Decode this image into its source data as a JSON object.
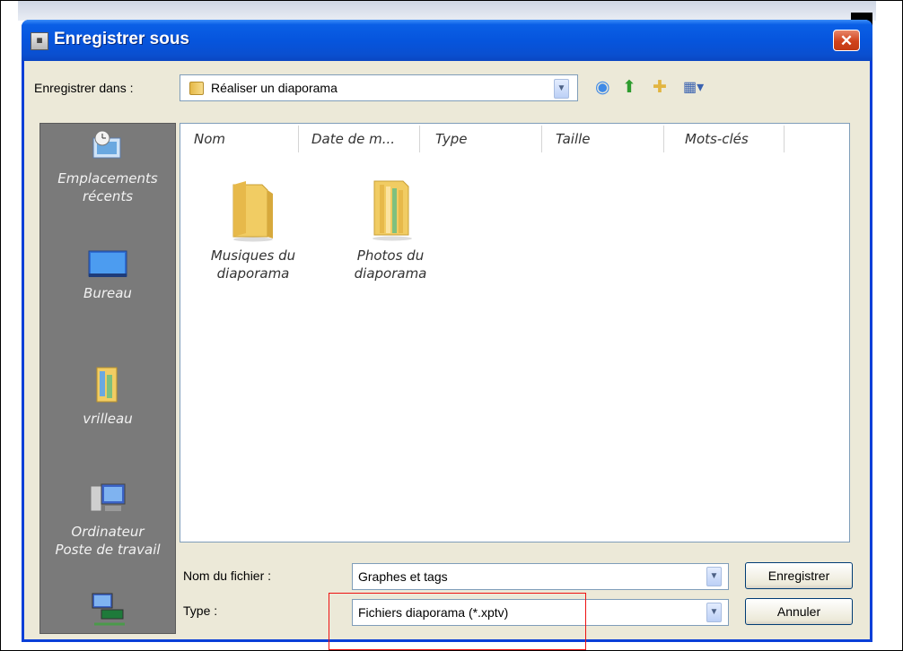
{
  "window": {
    "title": "Enregistrer sous",
    "close_symbol": "✕"
  },
  "location": {
    "label": "Enregistrer dans :",
    "current_folder": "Réaliser un diaporama"
  },
  "places": [
    {
      "label": "Emplacements\nrécents",
      "icon": "recent-places-icon"
    },
    {
      "label": "Bureau",
      "icon": "desktop-icon"
    },
    {
      "label": "vrilleau",
      "icon": "user-documents-icon"
    },
    {
      "label": "Ordinateur\nPoste de travail",
      "icon": "computer-icon"
    },
    {
      "label": "",
      "icon": "network-icon"
    }
  ],
  "columns": [
    "Nom",
    "Date de m...",
    "Type",
    "Taille",
    "Mots-clés"
  ],
  "files": [
    {
      "name": "Musiques du\ndiaporama",
      "icon": "folder-icon"
    },
    {
      "name": "Photos du\ndiaporama",
      "icon": "folder-with-files-icon"
    }
  ],
  "filename": {
    "label": "Nom du fichier :",
    "value": "Graphes et tags"
  },
  "filetype": {
    "label": "Type :",
    "value": "Fichiers diaporama (*.xptv)"
  },
  "buttons": {
    "save": "Enregistrer",
    "cancel": "Annuler"
  },
  "colors": {
    "titlebar": "#0655dd",
    "dialog_bg": "#ece9d8",
    "highlight": "#ee1111"
  }
}
